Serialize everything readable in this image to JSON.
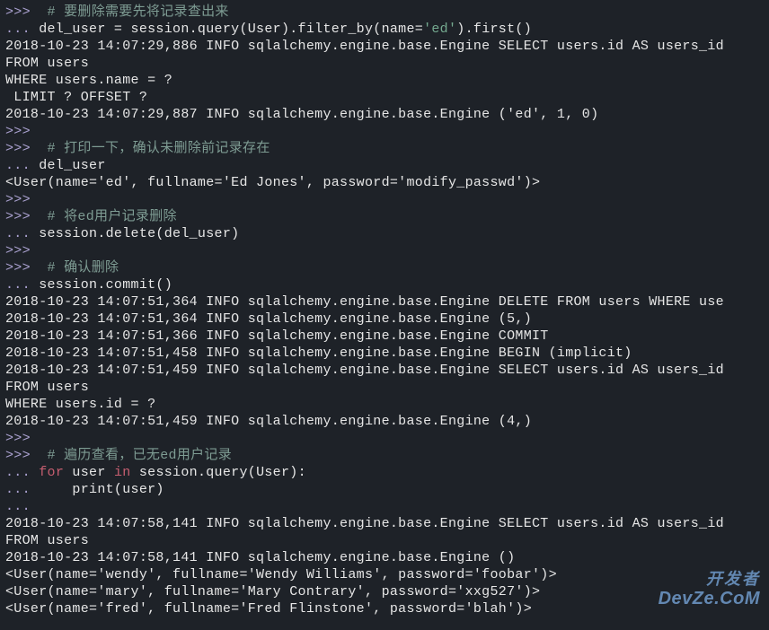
{
  "terminal": {
    "lines": [
      {
        "ps": ">>>",
        "cls": "cmt",
        "text": "  # 要删除需要先将记录查出来"
      },
      {
        "ps": "...",
        "cls": "",
        "seg": [
          {
            "t": " del_user = session.query(User).filter_by(name="
          },
          {
            "cls": "str",
            "t": "'ed'"
          },
          {
            "t": ").first()"
          }
        ]
      },
      {
        "cls": "",
        "text": "2018-10-23 14:07:29,886 INFO sqlalchemy.engine.base.Engine SELECT users.id AS users_id"
      },
      {
        "cls": "",
        "text": "FROM users"
      },
      {
        "cls": "",
        "text": "WHERE users.name = ?"
      },
      {
        "cls": "",
        "text": " LIMIT ? OFFSET ?"
      },
      {
        "cls": "",
        "text": "2018-10-23 14:07:29,887 INFO sqlalchemy.engine.base.Engine ('ed', 1, 0)"
      },
      {
        "ps": ">>>",
        "cls": "",
        "text": ""
      },
      {
        "ps": ">>>",
        "cls": "cmt",
        "text": "  # 打印一下，确认未删除前记录存在"
      },
      {
        "ps": "...",
        "cls": "",
        "text": " del_user"
      },
      {
        "cls": "",
        "text": "<User(name='ed', fullname='Ed Jones', password='modify_passwd')>"
      },
      {
        "ps": ">>>",
        "cls": "",
        "text": ""
      },
      {
        "ps": ">>>",
        "cls": "cmt",
        "text": "  # 将ed用户记录删除"
      },
      {
        "ps": "...",
        "cls": "",
        "text": " session.delete(del_user)"
      },
      {
        "ps": ">>>",
        "cls": "",
        "text": ""
      },
      {
        "ps": ">>>",
        "cls": "cmt",
        "text": "  # 确认删除"
      },
      {
        "ps": "...",
        "cls": "",
        "text": " session.commit()"
      },
      {
        "cls": "",
        "text": "2018-10-23 14:07:51,364 INFO sqlalchemy.engine.base.Engine DELETE FROM users WHERE use"
      },
      {
        "cls": "",
        "text": "2018-10-23 14:07:51,364 INFO sqlalchemy.engine.base.Engine (5,)"
      },
      {
        "cls": "",
        "text": "2018-10-23 14:07:51,366 INFO sqlalchemy.engine.base.Engine COMMIT"
      },
      {
        "cls": "",
        "text": "2018-10-23 14:07:51,458 INFO sqlalchemy.engine.base.Engine BEGIN (implicit)"
      },
      {
        "cls": "",
        "text": "2018-10-23 14:07:51,459 INFO sqlalchemy.engine.base.Engine SELECT users.id AS users_id"
      },
      {
        "cls": "",
        "text": "FROM users"
      },
      {
        "cls": "",
        "text": "WHERE users.id = ?"
      },
      {
        "cls": "",
        "text": "2018-10-23 14:07:51,459 INFO sqlalchemy.engine.base.Engine (4,)"
      },
      {
        "ps": ">>>",
        "cls": "",
        "text": ""
      },
      {
        "ps": ">>>",
        "cls": "cmt",
        "text": "  # 遍历查看，已无ed用户记录"
      },
      {
        "ps": "...",
        "seg": [
          {
            "t": " "
          },
          {
            "cls": "kw",
            "t": "for"
          },
          {
            "t": " user "
          },
          {
            "cls": "kw",
            "t": "in"
          },
          {
            "t": " session.query(User):"
          }
        ]
      },
      {
        "ps": "...",
        "cls": "",
        "text": "     print(user)"
      },
      {
        "ps": "...",
        "cls": "",
        "text": ""
      },
      {
        "cls": "",
        "text": "2018-10-23 14:07:58,141 INFO sqlalchemy.engine.base.Engine SELECT users.id AS users_id"
      },
      {
        "cls": "",
        "text": "FROM users"
      },
      {
        "cls": "",
        "text": "2018-10-23 14:07:58,141 INFO sqlalchemy.engine.base.Engine ()"
      },
      {
        "cls": "",
        "text": "<User(name='wendy', fullname='Wendy Williams', password='foobar')>"
      },
      {
        "cls": "",
        "text": "<User(name='mary', fullname='Mary Contrary', password='xxg527')>"
      },
      {
        "cls": "",
        "text": "<User(name='fred', fullname='Fred Flinstone', password='blah')>"
      }
    ]
  },
  "watermark": {
    "line1": "开发者",
    "line2": "DevZe.CoM"
  }
}
